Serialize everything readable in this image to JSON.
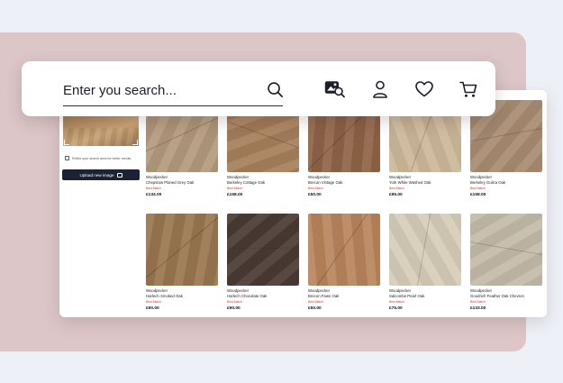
{
  "search": {
    "placeholder": "Enter you search...",
    "icons": [
      "search-icon",
      "image-search-icon",
      "account-icon",
      "wishlist-heart-icon",
      "cart-icon"
    ]
  },
  "sidebar": {
    "hint": "Refine your search area for better results",
    "upload_label": "Upload new image"
  },
  "colors": {
    "background": "#eef0f8",
    "panel": "#dcc6c7",
    "button_dark": "#1c2233",
    "badge_red": "#d23b3b"
  },
  "products": [
    {
      "brand": "Woodpecker",
      "name": "Chepstow Planed Grey Oak",
      "badge": "Best Match",
      "price": "£134.00",
      "swatch": "#b39a7d"
    },
    {
      "brand": "Woodpecker",
      "name": "Berkeley Cottage Oak",
      "badge": "Best Match",
      "price": "£158.00",
      "swatch": "#a77f5a"
    },
    {
      "brand": "Woodpecker",
      "name": "Brecon Vintage Oak",
      "badge": "Best Match",
      "price": "£50.00",
      "swatch": "#8f6447"
    },
    {
      "brand": "Woodpecker",
      "name": "York White Washed Oak",
      "badge": "Best Match",
      "price": "£95.00",
      "swatch": "#cdb89a"
    },
    {
      "brand": "Woodpecker",
      "name": "Berkeley Gulica Oak",
      "badge": "Best Match",
      "price": "£158.00",
      "swatch": "#a88c72"
    },
    {
      "brand": "Woodpecker",
      "name": "Harlech Smoked Oak",
      "badge": "Best Match",
      "price": "£90.00",
      "swatch": "#9a7650"
    },
    {
      "brand": "Woodpecker",
      "name": "Harlech Chocolate Oak",
      "badge": "Best Match",
      "price": "£90.00",
      "swatch": "#4a3a33"
    },
    {
      "brand": "Woodpecker",
      "name": "Brecon Fawn Oak",
      "badge": "Best Match",
      "price": "£50.00",
      "swatch": "#b8855c"
    },
    {
      "brand": "Woodpecker",
      "name": "Salcombe Pearl Oak",
      "badge": "Best Match",
      "price": "£75.00",
      "swatch": "#d6ccb8"
    },
    {
      "brand": "Woodpecker",
      "name": "Goodrich Feather Oak Chevron",
      "badge": "Best Match",
      "price": "£133.00",
      "swatch": "#c4bba9"
    }
  ]
}
